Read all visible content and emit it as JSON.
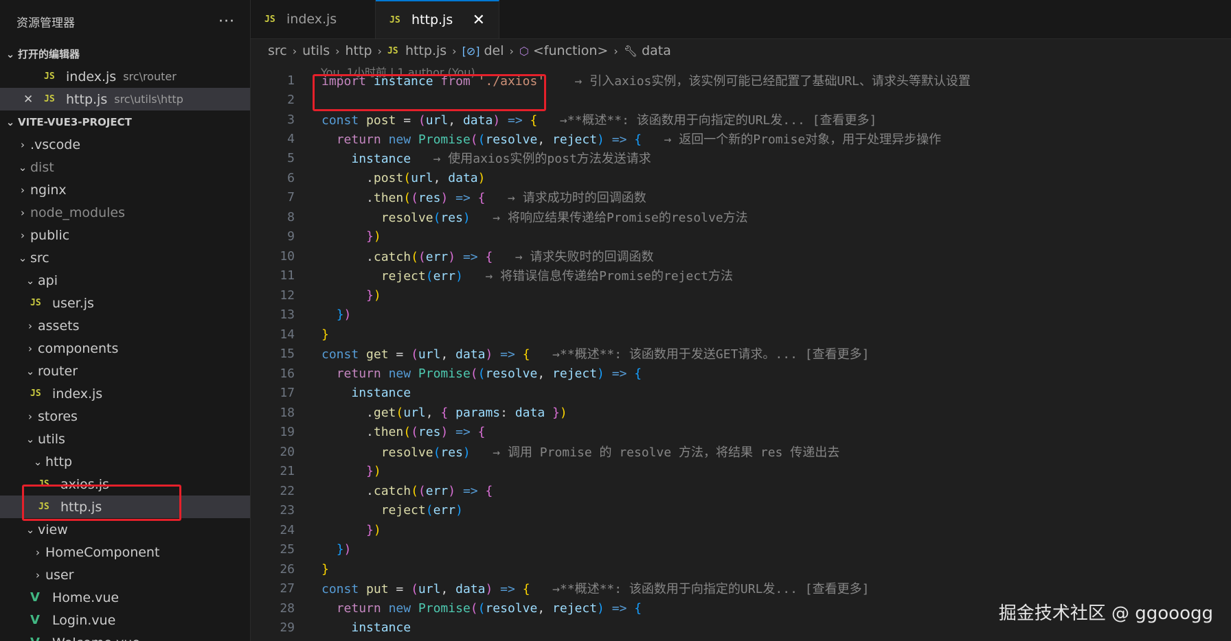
{
  "explorer": {
    "title": "资源管理器",
    "more": "···",
    "open_editors_label": "打开的编辑器",
    "open_editors": [
      {
        "name": "index.js",
        "desc": "src\\router"
      },
      {
        "name": "http.js",
        "desc": "src\\utils\\http"
      }
    ],
    "project_label": "VITE-VUE3-PROJECT",
    "tree": [
      {
        "label": ".vscode"
      },
      {
        "label": "dist"
      },
      {
        "label": "nginx"
      },
      {
        "label": "node_modules"
      },
      {
        "label": "public"
      },
      {
        "label": "src"
      },
      {
        "label": "api"
      },
      {
        "label": "user.js"
      },
      {
        "label": "assets"
      },
      {
        "label": "components"
      },
      {
        "label": "router"
      },
      {
        "label": "index.js"
      },
      {
        "label": "stores"
      },
      {
        "label": "utils"
      },
      {
        "label": "http"
      },
      {
        "label": "axios.js"
      },
      {
        "label": "http.js"
      },
      {
        "label": "view"
      },
      {
        "label": "HomeComponent"
      },
      {
        "label": "user"
      },
      {
        "label": "Home.vue"
      },
      {
        "label": "Login.vue"
      },
      {
        "label": "Welcome.vue"
      }
    ]
  },
  "tabs": [
    {
      "label": "index.js",
      "badge": "JS"
    },
    {
      "label": "http.js",
      "badge": "JS",
      "close": "✕"
    }
  ],
  "breadcrumb": [
    "src",
    "utils",
    "http",
    "http.js",
    "del",
    "<function>",
    "data"
  ],
  "blame": "You, 1小时前 | 1 author (You)",
  "line_numbers": [
    "1",
    "2",
    "3",
    "4",
    "5",
    "6",
    "7",
    "8",
    "9",
    "10",
    "11",
    "12",
    "13",
    "14",
    "15",
    "16",
    "17",
    "18",
    "19",
    "20",
    "21",
    "22",
    "23",
    "24",
    "25",
    "26",
    "27",
    "28",
    "29"
  ],
  "hints": {
    "l1": "→ 引入axios实例，该实例可能已经配置了基础URL、请求头等默认设置",
    "l3": "→**概述**: 该函数用于向指定的URL发... [查看更多]",
    "l4": "→ 返回一个新的Promise对象，用于处理异步操作",
    "l5": "→ 使用axios实例的post方法发送请求",
    "l7": "→ 请求成功时的回调函数",
    "l8": "→ 将响应结果传递给Promise的resolve方法",
    "l10": "→ 请求失败时的回调函数",
    "l11": "→ 将错误信息传递给Promise的reject方法",
    "l15": "→**概述**: 该函数用于发送GET请求。... [查看更多]",
    "l20": "→ 调用 Promise 的 resolve 方法，将结果 res 传递出去",
    "l27": "→**概述**: 该函数用于向指定的URL发... [查看更多]"
  },
  "watermark": "掘金技术社区 @ ggooogg"
}
